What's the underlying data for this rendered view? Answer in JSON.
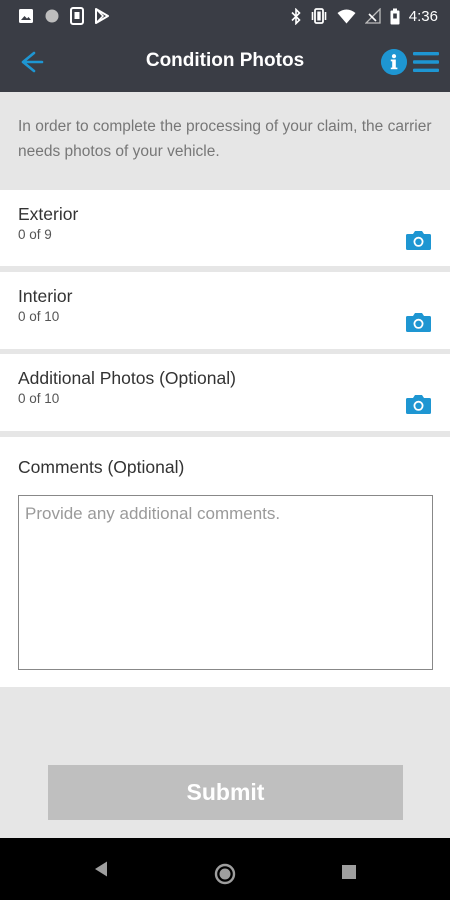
{
  "status_bar": {
    "time": "4:36"
  },
  "app_bar": {
    "title": "Condition Photos"
  },
  "intro_text": "In order to complete the processing of your claim, the carrier needs photos of your vehicle.",
  "photo_sections": [
    {
      "title": "Exterior",
      "count": "0 of 9"
    },
    {
      "title": "Interior",
      "count": "0 of 10"
    },
    {
      "title": "Additional Photos (Optional)",
      "count": "0 of 10"
    }
  ],
  "comments": {
    "label": "Comments (Optional)",
    "placeholder": "Provide any additional comments.",
    "value": ""
  },
  "submit_label": "Submit",
  "colors": {
    "accent": "#1e96d2",
    "app_bar": "#3a3d45",
    "disabled_button": "#bfbfbf"
  },
  "icons": [
    "image-icon",
    "circle-icon",
    "sim-icon",
    "play-store-icon",
    "bluetooth-icon",
    "vibrate-icon",
    "wifi-icon",
    "no-signal-icon",
    "battery-icon",
    "back-arrow-icon",
    "info-icon",
    "menu-icon",
    "camera-icon",
    "nav-back-icon",
    "nav-home-icon",
    "nav-recents-icon"
  ]
}
